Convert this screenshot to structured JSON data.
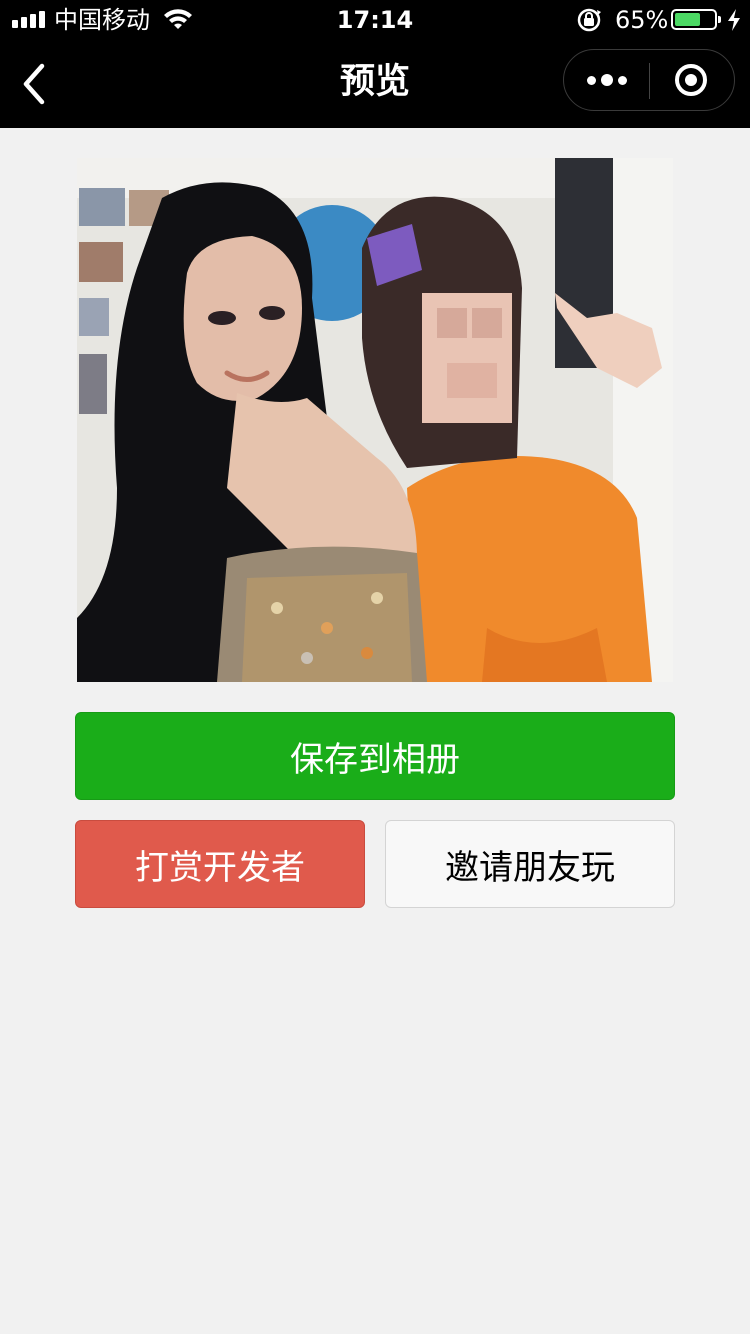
{
  "status_bar": {
    "carrier": "中国移动",
    "time": "17:14",
    "battery_percent": "65%",
    "battery_level": 0.65,
    "icons": [
      "signal-icon",
      "wifi-icon",
      "orientation-lock-icon",
      "battery-icon",
      "charging-bolt-icon"
    ]
  },
  "nav": {
    "title": "预览",
    "back_icon": "chevron-left-icon",
    "more_icon": "more-dots-icon",
    "close_icon": "target-circle-icon"
  },
  "preview": {
    "image_description_name": "preview-photo"
  },
  "buttons": {
    "save": "保存到相册",
    "reward": "打赏开发者",
    "invite": "邀请朋友玩"
  },
  "colors": {
    "primary_green": "#1aad19",
    "reward_red": "#e05a4c",
    "background": "#f1f1f1"
  }
}
